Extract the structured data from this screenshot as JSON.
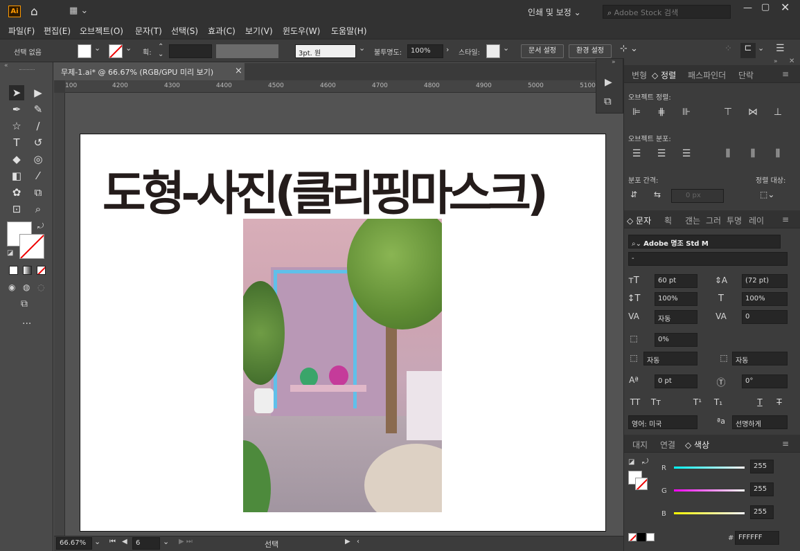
{
  "app": {
    "logo": "Ai",
    "workspace": "인쇄 및 보정",
    "stock_placeholder": "Adobe Stock 검색"
  },
  "menu": [
    "파일(F)",
    "편집(E)",
    "오브젝트(O)",
    "문자(T)",
    "선택(S)",
    "효과(C)",
    "보기(V)",
    "윈도우(W)",
    "도움말(H)"
  ],
  "control": {
    "selection": "선택 없음",
    "stroke_label": "획:",
    "brush": "3pt. 원",
    "opacity_label": "불투명도:",
    "opacity": "100%",
    "style_label": "스타일:",
    "doc_setup": "문서 설정",
    "prefs": "환경 설정"
  },
  "doc": {
    "tab_title": "무제-1.ai* @ 66.67% (RGB/GPU 미리 보기)",
    "close": "×"
  },
  "ruler": {
    "h": [
      "100",
      "4200",
      "4300",
      "4400",
      "4500",
      "4600",
      "4700",
      "4800",
      "4900",
      "5000",
      "5100"
    ]
  },
  "artboard": {
    "heading": "도형-사진(클리핑마스크)"
  },
  "status": {
    "zoom": "66.67%",
    "page": "6",
    "mode": "선택"
  },
  "align": {
    "tabs": [
      "변형",
      "정렬",
      "패스파인더",
      "단락"
    ],
    "active": "정렬",
    "obj_align": "오브젝트 정렬:",
    "obj_dist": "오브젝트 분포:",
    "dist_space": "분포 간격:",
    "align_to": "정렬 대상:",
    "space_val": "0 px"
  },
  "type": {
    "tabs": [
      "문자",
      "획",
      "걘는",
      "그러",
      "투명",
      "레이"
    ],
    "font": "Adobe 명조 Std M",
    "style": "-",
    "size": "60 pt",
    "leading": "(72 pt)",
    "vscale": "100%",
    "hscale": "100%",
    "kern": "자동",
    "track": "0",
    "tsume": "0%",
    "aki1": "자동",
    "aki2": "자동",
    "baseline": "0 pt",
    "rotate": "0°",
    "lang": "영어: 미국",
    "aa": "선명하게"
  },
  "color": {
    "tabs": [
      "대지",
      "연결",
      "색상"
    ],
    "r": "255",
    "g": "255",
    "b": "255",
    "hex": "FFFFFF",
    "r_label": "R",
    "g_label": "G",
    "b_label": "B",
    "hash": "#"
  }
}
